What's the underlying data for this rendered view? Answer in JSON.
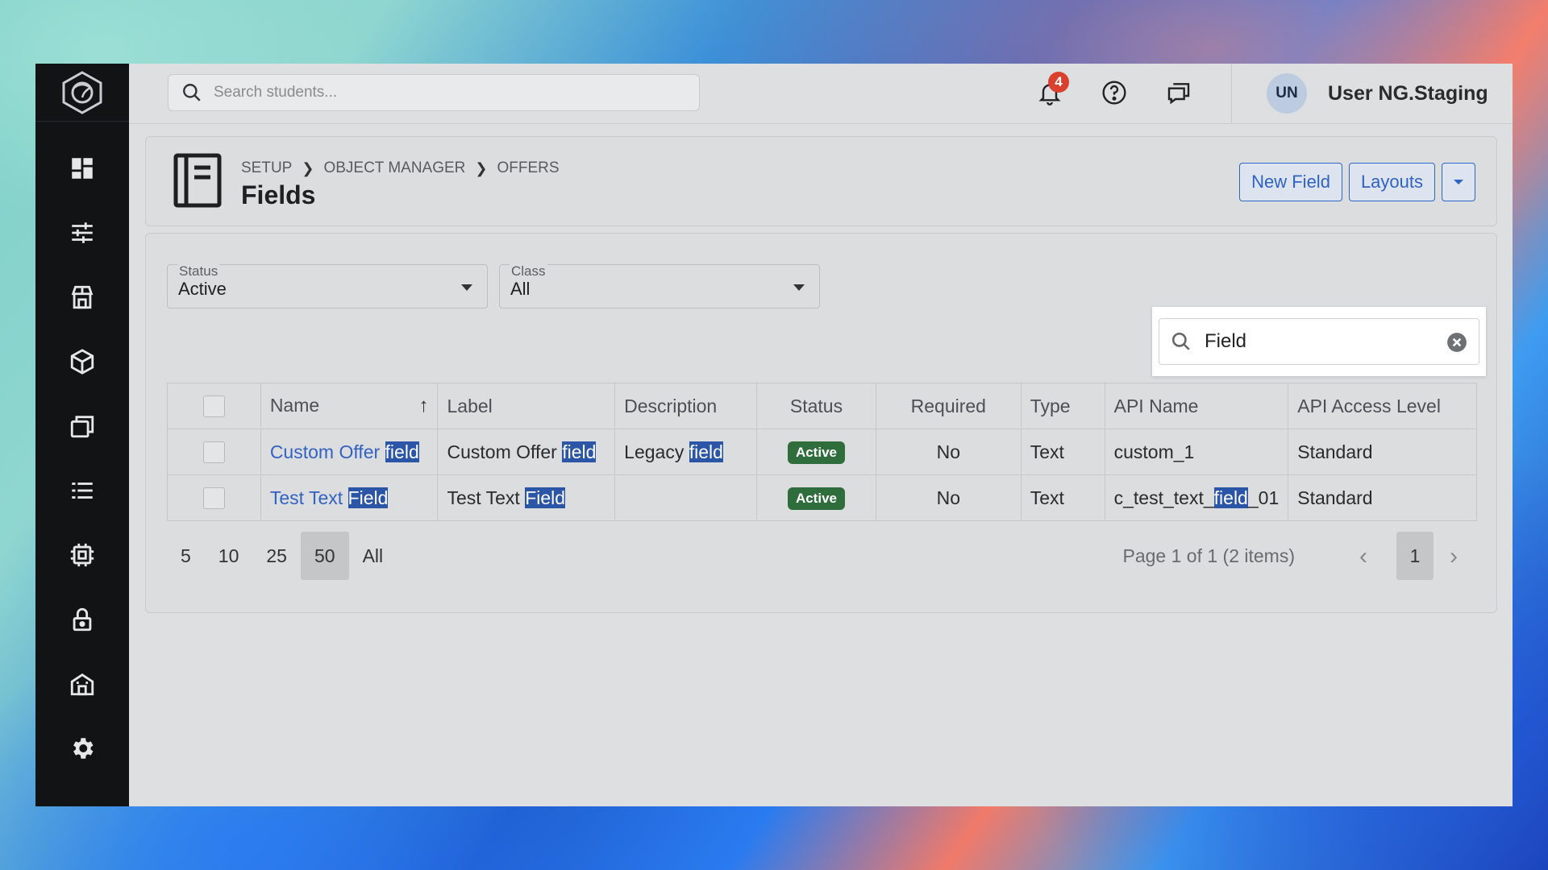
{
  "topbar": {
    "search_placeholder": "Search students...",
    "notifications_count": "4",
    "user_initials": "UN",
    "user_name": "User NG.Staging"
  },
  "sidebar": {
    "items": [
      {
        "icon": "dashboard-icon"
      },
      {
        "icon": "sliders-icon"
      },
      {
        "icon": "store-icon"
      },
      {
        "icon": "cube-icon"
      },
      {
        "icon": "layers-icon"
      },
      {
        "icon": "list-icon"
      },
      {
        "icon": "chip-icon"
      },
      {
        "icon": "lock-icon"
      },
      {
        "icon": "building-icon"
      },
      {
        "icon": "gear-icon"
      }
    ]
  },
  "header": {
    "breadcrumb": [
      "SETUP",
      "OBJECT MANAGER",
      "OFFERS"
    ],
    "title": "Fields",
    "new_field_label": "New Field",
    "layouts_label": "Layouts"
  },
  "filters": {
    "status_label": "Status",
    "status_value": "Active",
    "class_label": "Class",
    "class_value": "All"
  },
  "grid_search": {
    "value": "Field"
  },
  "table": {
    "columns": [
      "Name",
      "Label",
      "Description",
      "Status",
      "Required",
      "Type",
      "API Name",
      "API Access Level"
    ],
    "rows": [
      {
        "name_pre": "Custom Offer ",
        "name_hl": "field",
        "label_pre": "Custom Offer ",
        "label_hl": "field",
        "desc_pre": "Legacy ",
        "desc_hl": "field",
        "status": "Active",
        "required": "No",
        "type": "Text",
        "api_pre": "custom_1",
        "api_hl": "",
        "api_post": "",
        "access": "Standard"
      },
      {
        "name_pre": "Test Text ",
        "name_hl": "Field",
        "label_pre": "Test Text ",
        "label_hl": "Field",
        "desc_pre": "",
        "desc_hl": "",
        "status": "Active",
        "required": "No",
        "type": "Text",
        "api_pre": "c_test_text_",
        "api_hl": "field",
        "api_post": "_01",
        "access": "Standard"
      }
    ]
  },
  "pager": {
    "sizes": [
      "5",
      "10",
      "25",
      "50",
      "All"
    ],
    "selected_size": "50",
    "info": "Page 1 of 1 (2 items)",
    "current_page": "1"
  }
}
